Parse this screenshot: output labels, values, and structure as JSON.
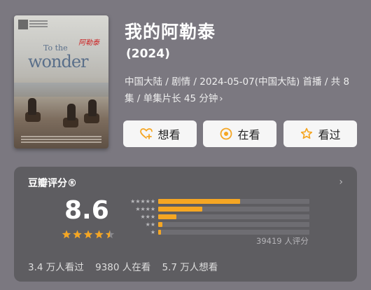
{
  "poster": {
    "title_line1": "To the",
    "title_line2": "wonder",
    "scribble": "阿勒泰"
  },
  "title": "我的阿勒泰",
  "year": "(2024)",
  "meta": "中国大陆 / 剧情 / 2024-05-07(中国大陆) 首播 / 共 8 集 / 单集片长 45 分钟",
  "actions": {
    "want": "想看",
    "watching": "在看",
    "watched": "看过"
  },
  "rating": {
    "section_title": "豆瓣评分®",
    "score": "8.6",
    "stars": 4.5,
    "count_text": "39419 人评分",
    "distribution": [
      {
        "label": "★★★★★",
        "fraction": 0.54
      },
      {
        "label": "★★★★",
        "fraction": 0.29
      },
      {
        "label": "★★★",
        "fraction": 0.12
      },
      {
        "label": "★★",
        "fraction": 0.03
      },
      {
        "label": "★",
        "fraction": 0.02
      }
    ]
  },
  "stats": {
    "watched": "3.4 万人看过",
    "watching": "9380 人在看",
    "want": "5.7 万人想看"
  },
  "colors": {
    "accent": "#f5a623",
    "background": "#7b7880",
    "card": "#5e5d61",
    "button": "#f6f6f6"
  }
}
